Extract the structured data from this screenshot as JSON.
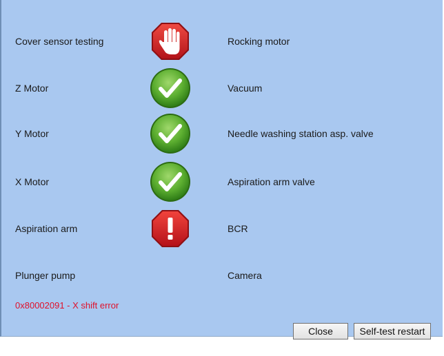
{
  "rows": [
    {
      "left": "Cover sensor testing",
      "status": "stop-hand-icon",
      "right": "Rocking motor"
    },
    {
      "left": "Z Motor",
      "status": "check-icon",
      "right": "Vacuum"
    },
    {
      "left": "Y Motor",
      "status": "check-icon",
      "right": "Needle washing station asp. valve"
    },
    {
      "left": "X Motor",
      "status": "check-icon",
      "right": "Aspiration arm valve"
    },
    {
      "left": "Aspiration arm",
      "status": "error-octagon-icon",
      "right": "BCR"
    },
    {
      "left": "Plunger pump",
      "status": "",
      "right": "Camera"
    }
  ],
  "error_message": "0x80002091 - X shift error",
  "buttons": {
    "close": "Close",
    "restart": "Self-test restart"
  },
  "colors": {
    "background": "#a9c8f0",
    "error_text": "#e0102a",
    "check_green": "#4fa32a",
    "stop_red": "#d8262a"
  }
}
